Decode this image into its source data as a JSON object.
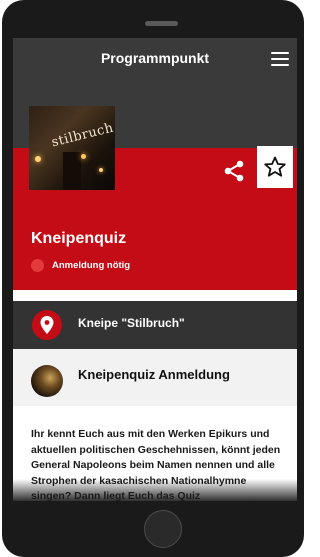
{
  "header": {
    "title": "Programmpunkt",
    "menu_icon": "hamburger-menu-icon"
  },
  "hero": {
    "image_sign_text": "stilbruch",
    "share_icon": "share-icon",
    "favorite_icon": "star-outline-icon",
    "event_title": "Kneipenquiz",
    "status_text": "Anmeldung nötig",
    "status_color": "#e33b3b"
  },
  "venue": {
    "icon": "location-pin-icon",
    "name": "Kneipe \"Stilbruch\""
  },
  "registration": {
    "title": "Kneipenquiz Anmeldung"
  },
  "description": {
    "text": "Ihr kennt Euch aus mit den Werken Epikurs und aktuellen politischen Geschehnissen, könnt jeden General Napoleons beim Namen nennen und alle Strophen der kasachischen Nationalhymne singen? Dann liegt Euch das Quiz"
  },
  "colors": {
    "accent_red": "#c40c16",
    "header_dark": "#3a3a3a",
    "venue_row": "#333333"
  }
}
